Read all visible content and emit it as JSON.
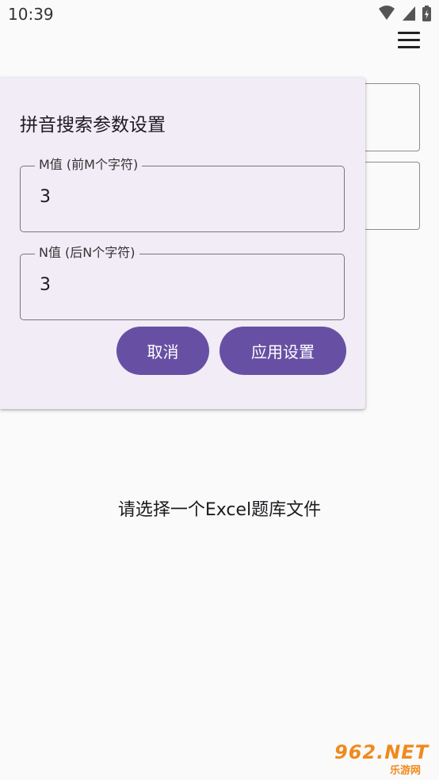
{
  "status_bar": {
    "time": "10:39"
  },
  "dialog": {
    "title": "拼音搜索参数设置",
    "m_field": {
      "label": "M值 (前M个字符)",
      "value": "3"
    },
    "n_field": {
      "label": "N值 (后N个字符)",
      "value": "3"
    },
    "cancel_label": "取消",
    "apply_label": "应用设置"
  },
  "main": {
    "hint": "请选择一个Excel题库文件"
  },
  "watermark": {
    "brand": "962.NET",
    "sub": "乐游网"
  },
  "colors": {
    "accent": "#6750a4",
    "dialog_bg": "#f2ecf6",
    "watermark": "#f08a1c"
  }
}
